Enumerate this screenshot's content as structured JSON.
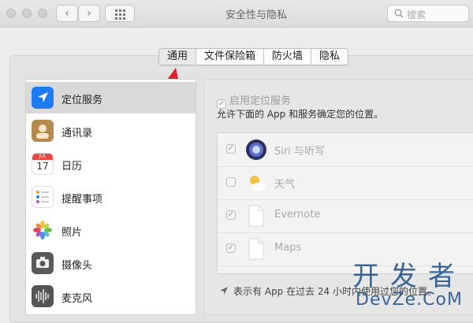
{
  "window": {
    "title": "安全性与隐私"
  },
  "toolbar": {
    "search_placeholder": "搜索"
  },
  "tabs": [
    {
      "label": "通用",
      "selected": true
    },
    {
      "label": "文件保险箱",
      "selected": false
    },
    {
      "label": "防火墙",
      "selected": false
    },
    {
      "label": "隐私",
      "selected": false
    }
  ],
  "sidebar": {
    "items": [
      {
        "label": "定位服务",
        "icon": "location-icon",
        "selected": true
      },
      {
        "label": "通讯录",
        "icon": "contacts-icon",
        "selected": false
      },
      {
        "label": "日历",
        "icon": "calendar-icon",
        "selected": false
      },
      {
        "label": "提醒事项",
        "icon": "reminders-icon",
        "selected": false
      },
      {
        "label": "照片",
        "icon": "photos-icon",
        "selected": false
      },
      {
        "label": "摄像头",
        "icon": "camera-icon",
        "selected": false
      },
      {
        "label": "麦克风",
        "icon": "microphone-icon",
        "selected": false
      }
    ]
  },
  "calendar_icon": {
    "month": "JUL",
    "day": "17"
  },
  "location": {
    "enable_label": "启用定位服务",
    "enabled": true,
    "description": "允许下面的 App 和服务确定您的位置。",
    "apps": [
      {
        "label": "Siri 与听写",
        "checked": true,
        "icon": "siri-icon"
      },
      {
        "label": "天气",
        "checked": false,
        "icon": "weather-icon"
      },
      {
        "label": "Evernote",
        "checked": true,
        "icon": "document-icon"
      },
      {
        "label": "Maps",
        "checked": true,
        "icon": "document-icon"
      }
    ],
    "hint": "表示有 App 在过去 24 小时内使用过您的位置。"
  },
  "watermark": {
    "line1": "开发者",
    "line2": "DevZe.CoM"
  },
  "colors": {
    "accent": "#1e7cf2",
    "arrow": "#e0232b",
    "watermark": "#1a4f8a"
  }
}
